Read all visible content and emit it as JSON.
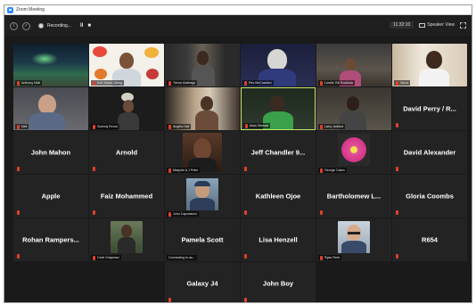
{
  "window": {
    "title": "Zoom Meeting"
  },
  "toolbar": {
    "recording_label": "Recording...",
    "pause_glyph": "II",
    "stop_glyph": "■",
    "timer": "11:32:10",
    "view_label": "Speaker View"
  },
  "tiles": {
    "r1c1": {
      "caption": "Anthony Nkiti"
    },
    "r1c2": {
      "caption": "Kofi Zakari-Oteng"
    },
    "r1c3": {
      "caption": "Trevor Adebayo"
    },
    "r1c4": {
      "caption": "Rev McCracken"
    },
    "r1c5": {
      "caption": "Lorelle Gill Ruddock"
    },
    "r1c6": {
      "caption": "Steve"
    },
    "r2c1": {
      "caption": "Neil"
    },
    "r2c2": {
      "caption": "Sukhraj Rehal"
    },
    "r2c3": {
      "caption": "Angela Hall"
    },
    "r2c4": {
      "caption": "Allan Stewart"
    },
    "r2c5": {
      "caption": "Larry Judkins"
    },
    "r2c6": {
      "name": "David Perry / R..."
    },
    "r3c1": {
      "name": "John Mahon"
    },
    "r3c2": {
      "name": "Arnold"
    },
    "r3c3": {
      "caption": "Marjorie A J Peter"
    },
    "r3c4": {
      "name": "Jeff Chandler 9..."
    },
    "r3c5": {
      "caption": "George Caton"
    },
    "r3c6": {
      "name": "David Alexander"
    },
    "r4c1": {
      "name": "Apple"
    },
    "r4c2": {
      "name": "Faiz Mohammed"
    },
    "r4c3": {
      "caption": "John Capodanno"
    },
    "r4c4": {
      "name": "Kathleen Ojoe"
    },
    "r4c5": {
      "name": "Bartholomew L..."
    },
    "r4c6": {
      "name": "Gloria Coombs"
    },
    "r5c1": {
      "name": "Rohan Rampers..."
    },
    "r5c2": {
      "caption": "Cecil Chapman"
    },
    "r5c3": {
      "name": "Pamela Scott",
      "caption": "Connecting to au..."
    },
    "r5c4": {
      "name": "Lisa Henzell"
    },
    "r5c5": {
      "caption": "Ryan Reid"
    },
    "r5c6": {
      "name": "R654"
    },
    "r6c3": {
      "name": "Galaxy J4"
    },
    "r6c4": {
      "name": "John Boy"
    }
  },
  "colors": {
    "active_speaker_border": "#c8e870",
    "muted_mic": "#e0402b",
    "tile_bg": "#232323"
  },
  "icons": [
    "zoom-logo-icon",
    "info-icon",
    "shield-icon",
    "record-icon",
    "pause-icon",
    "stop-icon",
    "speaker-view-icon",
    "fullscreen-icon",
    "mic-muted-icon"
  ]
}
